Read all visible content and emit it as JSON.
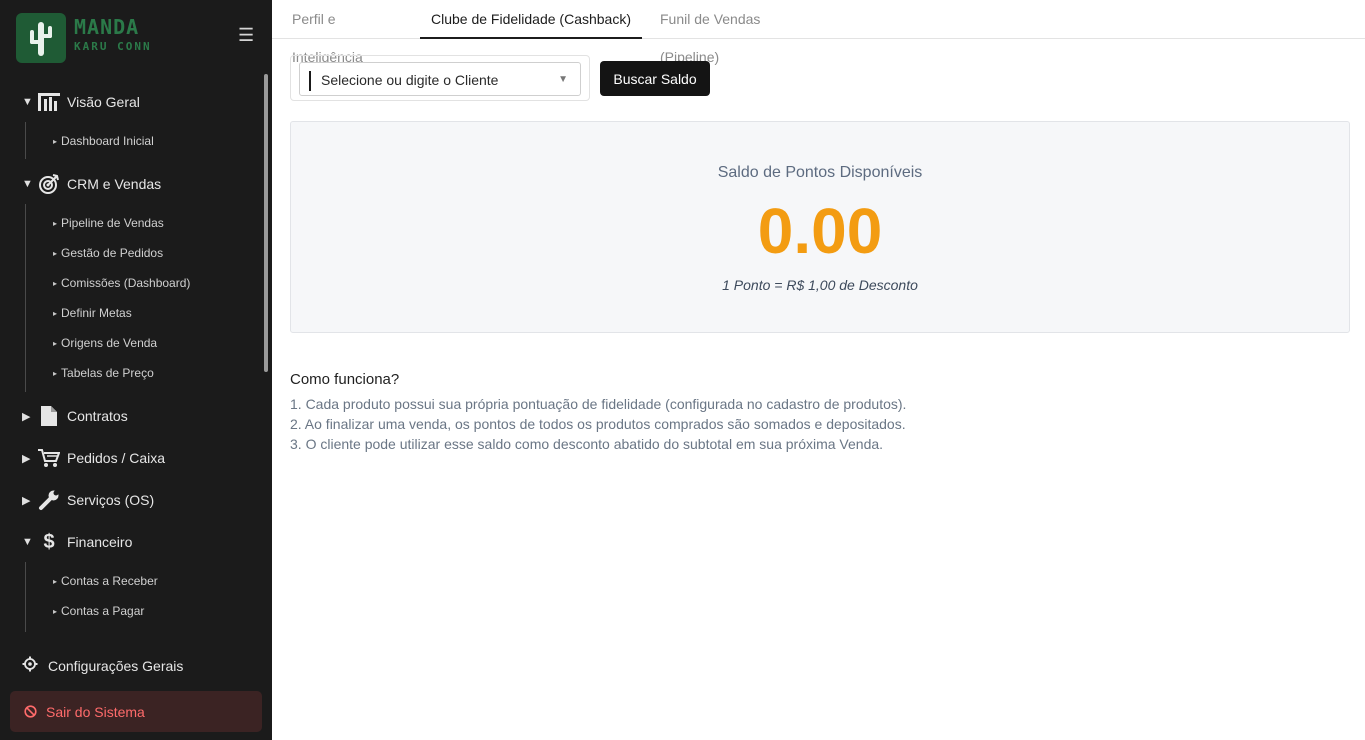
{
  "sidebar": {
    "brand": {
      "line1": "MANDA",
      "line2": "KARU CONN"
    },
    "groups": [
      {
        "label": "Visão Geral",
        "icon": "chart-bars-icon",
        "expanded": true,
        "items": [
          "Dashboard Inicial"
        ]
      },
      {
        "label": "CRM e Vendas",
        "icon": "target-icon",
        "expanded": true,
        "items": [
          "Pipeline de Vendas",
          "Gestão de Pedidos",
          "Comissões (Dashboard)",
          "Definir Metas",
          "Origens de Venda",
          "Tabelas de Preço"
        ]
      },
      {
        "label": "Contratos",
        "icon": "document-icon",
        "expanded": false
      },
      {
        "label": "Pedidos / Caixa",
        "icon": "cart-icon",
        "expanded": false
      },
      {
        "label": "Serviços (OS)",
        "icon": "wrench-icon",
        "expanded": false
      },
      {
        "label": "Financeiro",
        "icon": "dollar-icon",
        "expanded": true,
        "items": [
          "Contas a Receber",
          "Contas a Pagar"
        ]
      }
    ],
    "config_label": "Configurações Gerais",
    "logout_label": "Sair do Sistema"
  },
  "tabs": [
    {
      "label": "Perfil e Inteligência",
      "active": false
    },
    {
      "label": "Clube de Fidelidade (Cashback)",
      "active": true
    },
    {
      "label": "Funil de Vendas (Pipeline)",
      "active": false
    }
  ],
  "search": {
    "select_placeholder": "Selecione ou digite o Cliente",
    "button_label": "Buscar Saldo"
  },
  "balance": {
    "title": "Saldo de Pontos Disponíveis",
    "value": "0.00",
    "note": "1 Ponto = R$ 1,00 de Desconto"
  },
  "how_it_works": {
    "title": "Como funciona?",
    "lines": [
      "1. Cada produto possui sua própria pontuação de fidelidade (configurada no cadastro de produtos).",
      "2. Ao finalizar uma venda, os pontos de todos os produtos comprados são somados e depositados.",
      "3. O cliente pode utilizar esse saldo como desconto abatido do subtotal em sua próxima Venda."
    ]
  },
  "colors": {
    "sidebar_bg": "#1b1b1b",
    "brand_green": "#1f5b35",
    "points_orange": "#f39c12",
    "logout_red": "#ff6b6b"
  }
}
